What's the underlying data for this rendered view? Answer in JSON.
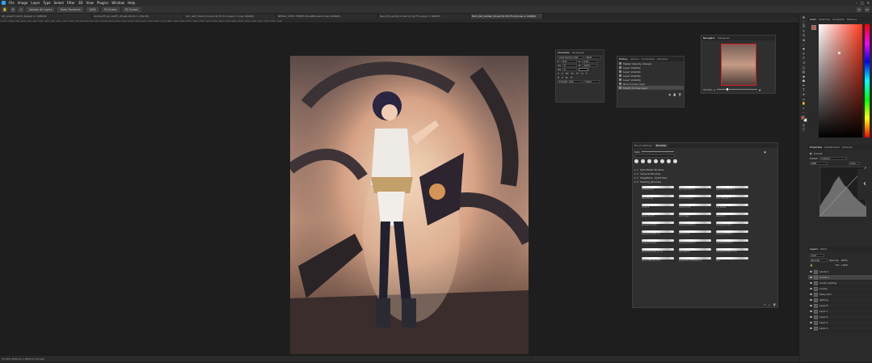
{
  "menu": [
    "File",
    "Image",
    "Layer",
    "Type",
    "Select",
    "Filter",
    "3D",
    "View",
    "Plugins",
    "Window",
    "Help"
  ],
  "options": {
    "tool_label": "Sample All Layers",
    "button_1": "Sample All Layers",
    "button_2": "Show Transform",
    "zoom": "100%",
    "fit_screen": "Fit Screen",
    "fill_screen": "Fill Screen"
  },
  "tabs": [
    "SD_pose® 19x15_Design to 1688.69",
    "Anime_EF-wo_test®_05.psb 8/1(to 1 ×PG 80)",
    "Girl_with_Sword_01.psd @ 33.3% (Layer 2 copy, RGB/8)",
    "NEW01_STH5.7TBPE0 NovaBRA Reluin 9ez (RGB/8)",
    "New_file_sprite_01.psd @ 16.7% (Layer 3, RGB/8)",
    "Tech_Girl_render_01.psd @ 33.3% (Curves 1, RGB/8)"
  ],
  "ruler_text": "-1100 -1000 -900 -800 -700 -600 -500 -400 -300 -200 -100 0 100 200 300 400 500 600 700 800 900 1000 1100 1200 1300 1400 1500 1600 1700 1800 1900 2000 2100 2200 2300 2400 2500 2600 2700 2800 2900 3000 3100 3200 3300 3400 3500",
  "status": "33.33%   3000 px x 3840 px (72 ppi)",
  "character_panel": {
    "tabs": [
      "Character",
      "Paragraph"
    ],
    "font": "Arial Kachel Trab",
    "style": "Bold",
    "size": "8 pt",
    "leading": "Auto",
    "tracking": "0",
    "scale": "100%",
    "language": "English: USA",
    "aa": "Sharp"
  },
  "history_panel": {
    "tabs": [
      "History",
      "Actions",
      "Comments",
      "Libraries"
    ],
    "items": [
      "Master Opacity Change",
      "Layer Visibility",
      "Layer Visibility",
      "Layer Visibility",
      "Layer Visibility",
      "Nine Curves Layer",
      "Modify Curves Layer"
    ]
  },
  "navigator_panel": {
    "tabs": [
      "Navigator",
      "Histogram"
    ],
    "zoom": "33.33%"
  },
  "brushes_panel": {
    "tabs": [
      "Brush Settings",
      "Brushes"
    ],
    "size_label": "Size:",
    "search_placeholder": "Search Brushes",
    "folders": [
      "Kyle Mister Brushes",
      "General Brushes",
      "MegaPack - KyleT Rew",
      "Painting_Brushes"
    ],
    "brushes": [
      [
        "Soft Round 1",
        "Kyle Hard Round",
        "Kyle Round Brush 1"
      ],
      [
        "Hard Round",
        "Round Brush 2",
        "Round Brush 3"
      ],
      [
        "Chalk 8",
        "Charcoal 19",
        "Dry Media"
      ],
      [
        "Brush Tip 32",
        "Wet Edges",
        "Pencil 12"
      ],
      [
        "Sampled Brush 1",
        "Sampled Brush 2",
        "Sampled Brush 3"
      ],
      [
        "Sampled Brush 4 4",
        "Soft Ink 19",
        "Sampled Brush 6"
      ],
      [
        "Sampled Brush 7",
        "Sampled Brush 8",
        "Sampled Brush 9"
      ],
      [
        "Sampled Brush 11 10",
        "Old Texture",
        "Sampled Brush 12 11"
      ],
      [
        "Round Blender 80 1",
        "Rough Round Bristle 14",
        "Fill 1"
      ]
    ]
  },
  "color_panel": {
    "tabs": [
      "Color",
      "Swatches",
      "Gradients",
      "Patterns"
    ],
    "foreground": "#c0523a",
    "background": "#ffffff",
    "hue": "#ff3b1f"
  },
  "properties_panel": {
    "tabs": [
      "Properties",
      "Adjustments",
      "Libraries"
    ],
    "title": "Curves",
    "preset_label": "Preset:",
    "preset": "Custom",
    "channel": "RGB",
    "auto": "Auto"
  },
  "layers_panel": {
    "tabs": [
      "Layers",
      "Paths"
    ],
    "kind": "Kind",
    "blend": "Normal",
    "opacity_label": "Opacity:",
    "opacity": "100%",
    "fill_label": "Fill:",
    "fill": "100%",
    "layers": [
      "Levels 2",
      "Curves 1",
      "render_lighting",
      "Curves",
      "base_color",
      "lighting",
      "Layer 8",
      "Layer 7",
      "Layer 6",
      "Layer 5",
      "Layer 4"
    ]
  },
  "colors": {
    "accent": "#c0523a",
    "panel": "#2f2f2f",
    "canvas": "#1e1e1e"
  }
}
